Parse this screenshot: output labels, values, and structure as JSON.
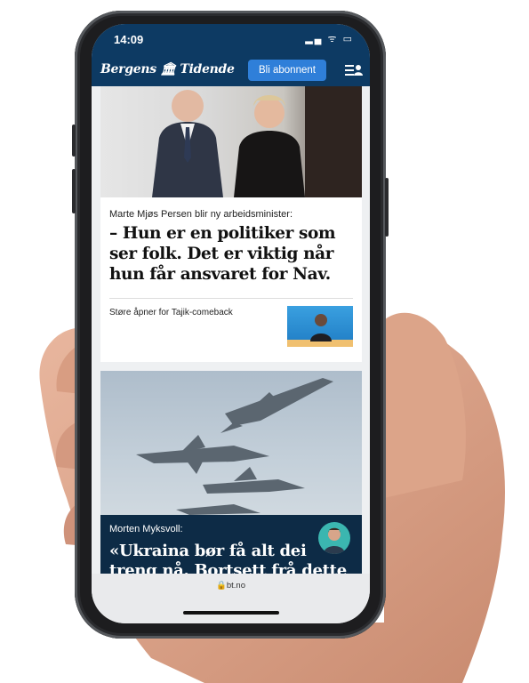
{
  "status_bar": {
    "time": "14:09",
    "icons": "▂▄ ᯤ ▭"
  },
  "header": {
    "logo": "Bergens 🏛 Tidende",
    "subscribe_label": "Bli abonnent"
  },
  "article1": {
    "kicker": "Marte Mjøs Persen blir ny arbeidsminister:",
    "headline": "– Hun er en politiker som ser folk. Det er viktig når hun får ansvaret for Nav.",
    "related": "Støre åpner for Tajik-comeback"
  },
  "article2": {
    "author": "Morten Myksvoll:",
    "headline": "«Ukraina bør få alt dei treng nå. Bortsett frå dette"
  },
  "browser": {
    "url": "🔒bt.no"
  },
  "colors": {
    "brand": "#0d3a63",
    "button": "#2f7fd9",
    "dark_card": "#0d2b46"
  }
}
